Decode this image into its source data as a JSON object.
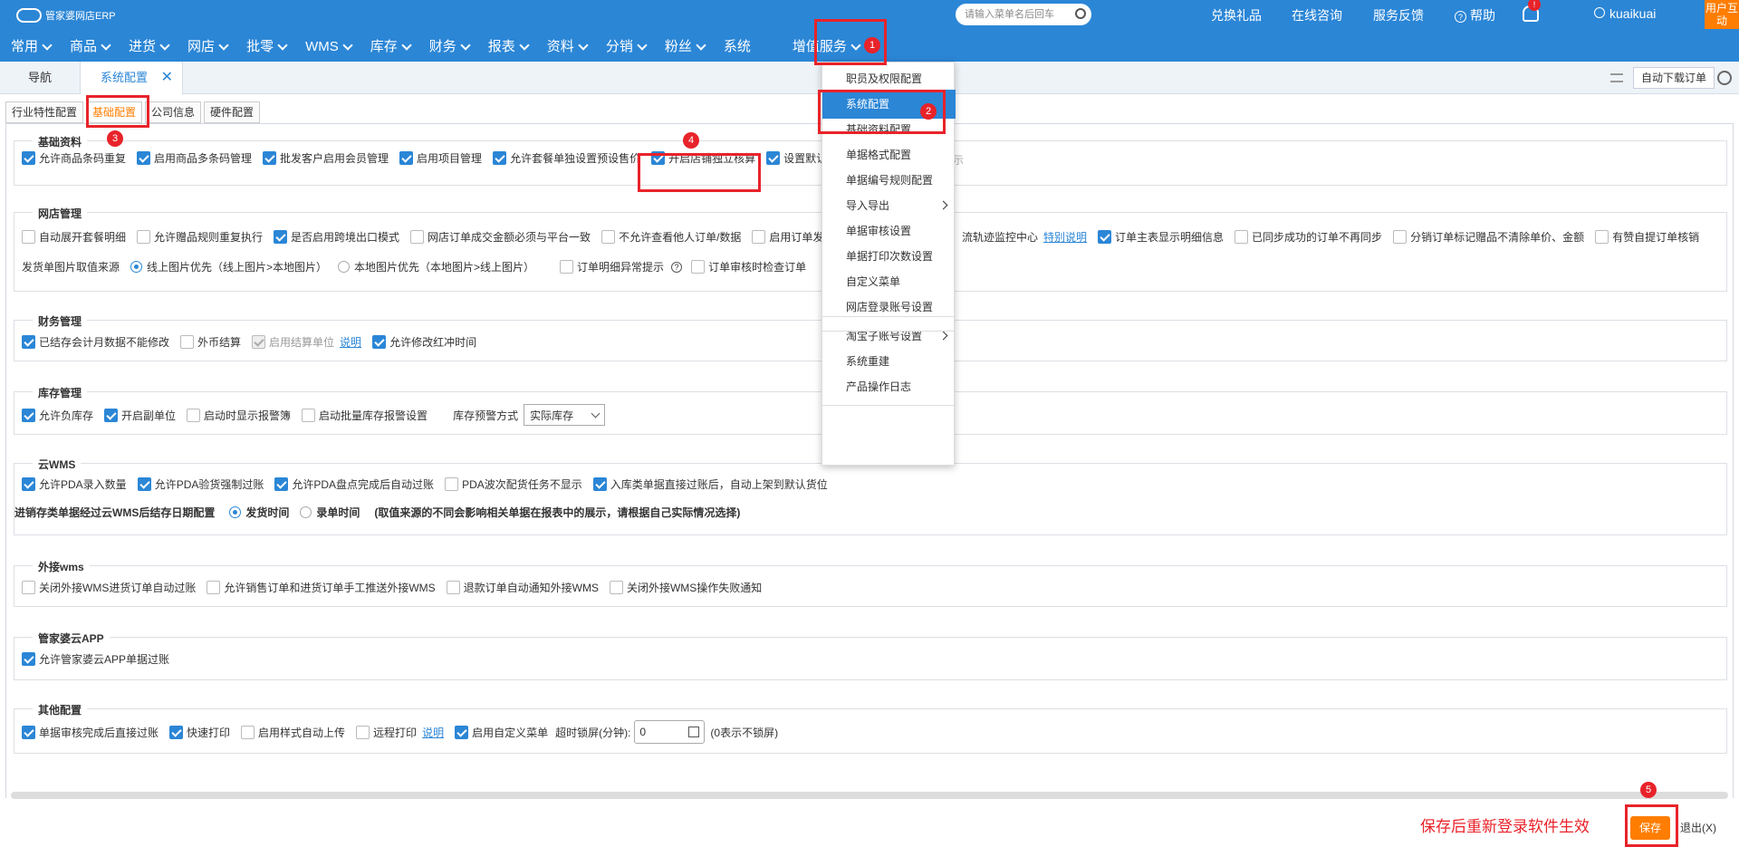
{
  "app": {
    "name": "管家婆网店ERP"
  },
  "search": {
    "placeholder": "请输入菜单名后回车"
  },
  "toplinks": {
    "gift": "兑换礼品",
    "consult": "在线咨询",
    "feedback": "服务反馈",
    "help": "帮助",
    "bell_count": "!",
    "user": "kuaikuai",
    "interact": "用户互动"
  },
  "menu": [
    "常用",
    "商品",
    "进货",
    "网店",
    "批零",
    "WMS",
    "库存",
    "财务",
    "报表",
    "资料",
    "分销",
    "粉丝",
    "系统",
    "增值服务"
  ],
  "tabs": {
    "nav": "导航",
    "config": "系统配置",
    "close": "✕",
    "auto_download": "自动下载订单"
  },
  "subtabs": [
    "行业特性配置",
    "基础配置",
    "公司信息",
    "硬件配置"
  ],
  "sections": {
    "basic": {
      "title": "基础资料",
      "items": [
        {
          "label": "允许商品条码重复",
          "checked": true
        },
        {
          "label": "启用商品多条码管理",
          "checked": true
        },
        {
          "label": "批发客户启用会员管理",
          "checked": true
        },
        {
          "label": "启用项目管理",
          "checked": true
        },
        {
          "label": "允许套餐单独设置预设售价",
          "checked": true
        },
        {
          "label": "开启店铺独立核算",
          "checked": true
        },
        {
          "label": "设置默认",
          "checked": true
        }
      ],
      "trailing": "示"
    },
    "shop": {
      "title": "网店管理",
      "row1": [
        {
          "label": "自动展开套餐明细",
          "checked": false
        },
        {
          "label": "允许赠品规则重复执行",
          "checked": false
        },
        {
          "label": "是否启用跨境出口模式",
          "checked": true
        },
        {
          "label": "网店订单成交金额必须与平台一致",
          "checked": false
        },
        {
          "label": "不允许查看他人订单/数据",
          "checked": false
        },
        {
          "label": "启用订单发",
          "checked": false
        }
      ],
      "row1_right": {
        "prefix": "流轨迹监控中心",
        "link": "特别说明",
        "items": [
          {
            "label": "订单主表显示明细信息",
            "checked": true
          },
          {
            "label": "已同步成功的订单不再同步",
            "checked": false
          },
          {
            "label": "分销订单标记赠品不清除单价、金额",
            "checked": false
          },
          {
            "label": "有赞自提订单核销",
            "checked": false
          }
        ]
      },
      "row2": {
        "label": "发货单图片取值来源",
        "radio1": "线上图片优先（线上图片>本地图片）",
        "radio2": "本地图片优先（本地图片>线上图片）",
        "cb1": "订单明细异常提示",
        "cb2": "订单审核时检查订单"
      }
    },
    "finance": {
      "title": "财务管理",
      "items": [
        {
          "label": "已结存会计月数据不能修改",
          "checked": true
        },
        {
          "label": "外币结算",
          "checked": false
        },
        {
          "label": "启用结算单位",
          "checked": true,
          "disabled": true
        },
        {
          "label": "允许修改红冲时间",
          "checked": true
        }
      ],
      "link": "说明"
    },
    "stock": {
      "title": "库存管理",
      "items": [
        {
          "label": "允许负库存",
          "checked": true
        },
        {
          "label": "开启副单位",
          "checked": true
        },
        {
          "label": "启动时显示报警簿",
          "checked": false
        },
        {
          "label": "启动批量库存报警设置",
          "checked": false
        }
      ],
      "alert_label": "库存预警方式",
      "alert_value": "实际库存"
    },
    "cloudwms": {
      "title": "云WMS",
      "items": [
        {
          "label": "允许PDA录入数量",
          "checked": true
        },
        {
          "label": "允许PDA验货强制过账",
          "checked": true
        },
        {
          "label": "允许PDA盘点完成后自动过账",
          "checked": true
        },
        {
          "label": "PDA波次配货任务不显示",
          "checked": false
        },
        {
          "label": "入库类单据直接过账后，自动上架到默认货位",
          "checked": true
        }
      ],
      "date_label": "进销存类单据经过云WMS后结存日期配置",
      "date_opt1": "发货时间",
      "date_opt2": "录单时间",
      "date_note": "(取值来源的不同会影响相关单据在报表中的展示，请根据自己实际情况选择)"
    },
    "extwms": {
      "title": "外接wms",
      "items": [
        {
          "label": "关闭外接WMS进货订单自动过账",
          "checked": false
        },
        {
          "label": "允许销售订单和进货订单手工推送外接WMS",
          "checked": false
        },
        {
          "label": "退款订单自动通知外接WMS",
          "checked": false
        },
        {
          "label": "关闭外接WMS操作失败通知",
          "checked": false
        }
      ]
    },
    "app": {
      "title": "管家婆云APP",
      "items": [
        {
          "label": "允许管家婆云APP单据过账",
          "checked": true
        }
      ]
    },
    "other": {
      "title": "其他配置",
      "items": [
        {
          "label": "单据审核完成后直接过账",
          "checked": true
        },
        {
          "label": "快速打印",
          "checked": true
        },
        {
          "label": "启用样式自动上传",
          "checked": false
        },
        {
          "label": "远程打印",
          "checked": false
        }
      ],
      "link": "说明",
      "custom_menu": "启用自定义菜单",
      "lock_label": "超时锁屏(分钟):",
      "lock_value": "0",
      "lock_note": "(0表示不锁屏)"
    }
  },
  "dropdown": [
    "职员及权限配置",
    "系统配置",
    "基础资料配置",
    "单据格式配置",
    "单据编号规则配置",
    "导入导出",
    "单据审核设置",
    "单据打印次数设置",
    "自定义菜单",
    "网店登录账号设置",
    "淘宝子账号设置",
    "系统重建",
    "产品操作日志"
  ],
  "annotations": [
    "1",
    "2",
    "3",
    "4",
    "5"
  ],
  "footer": {
    "hint": "保存后重新登录软件生效",
    "save": "保存",
    "exit": "退出(X)"
  },
  "colors": {
    "primary": "#2b86d6",
    "accent": "#ff7d00",
    "annotation": "#e8232a"
  }
}
